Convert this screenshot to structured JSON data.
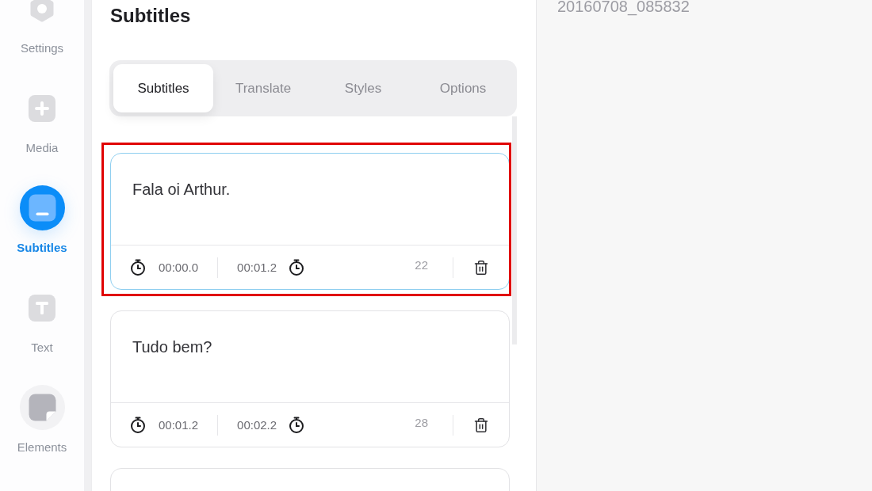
{
  "sidebar": {
    "items": [
      {
        "label": "Settings",
        "selected": false,
        "hovered": false
      },
      {
        "label": "Media",
        "selected": false,
        "hovered": false
      },
      {
        "label": "Subtitles",
        "selected": true,
        "hovered": false
      },
      {
        "label": "Text",
        "selected": false,
        "hovered": false
      },
      {
        "label": "Elements",
        "selected": false,
        "hovered": true
      }
    ]
  },
  "panel": {
    "title": "Subtitles",
    "tabs": [
      {
        "label": "Subtitles",
        "selected": true
      },
      {
        "label": "Translate",
        "selected": false
      },
      {
        "label": "Styles",
        "selected": false
      },
      {
        "label": "Options",
        "selected": false
      }
    ],
    "subtitles": [
      {
        "text": "Fala oi Arthur.",
        "start": "00:00.0",
        "end": "00:01.2",
        "count": "22",
        "selected": true,
        "highlighted": true
      },
      {
        "text": "Tudo bem?",
        "start": "00:01.2",
        "end": "00:02.2",
        "count": "28",
        "selected": false,
        "highlighted": false
      }
    ]
  },
  "preview": {
    "file_name": "20160708_085832"
  }
}
